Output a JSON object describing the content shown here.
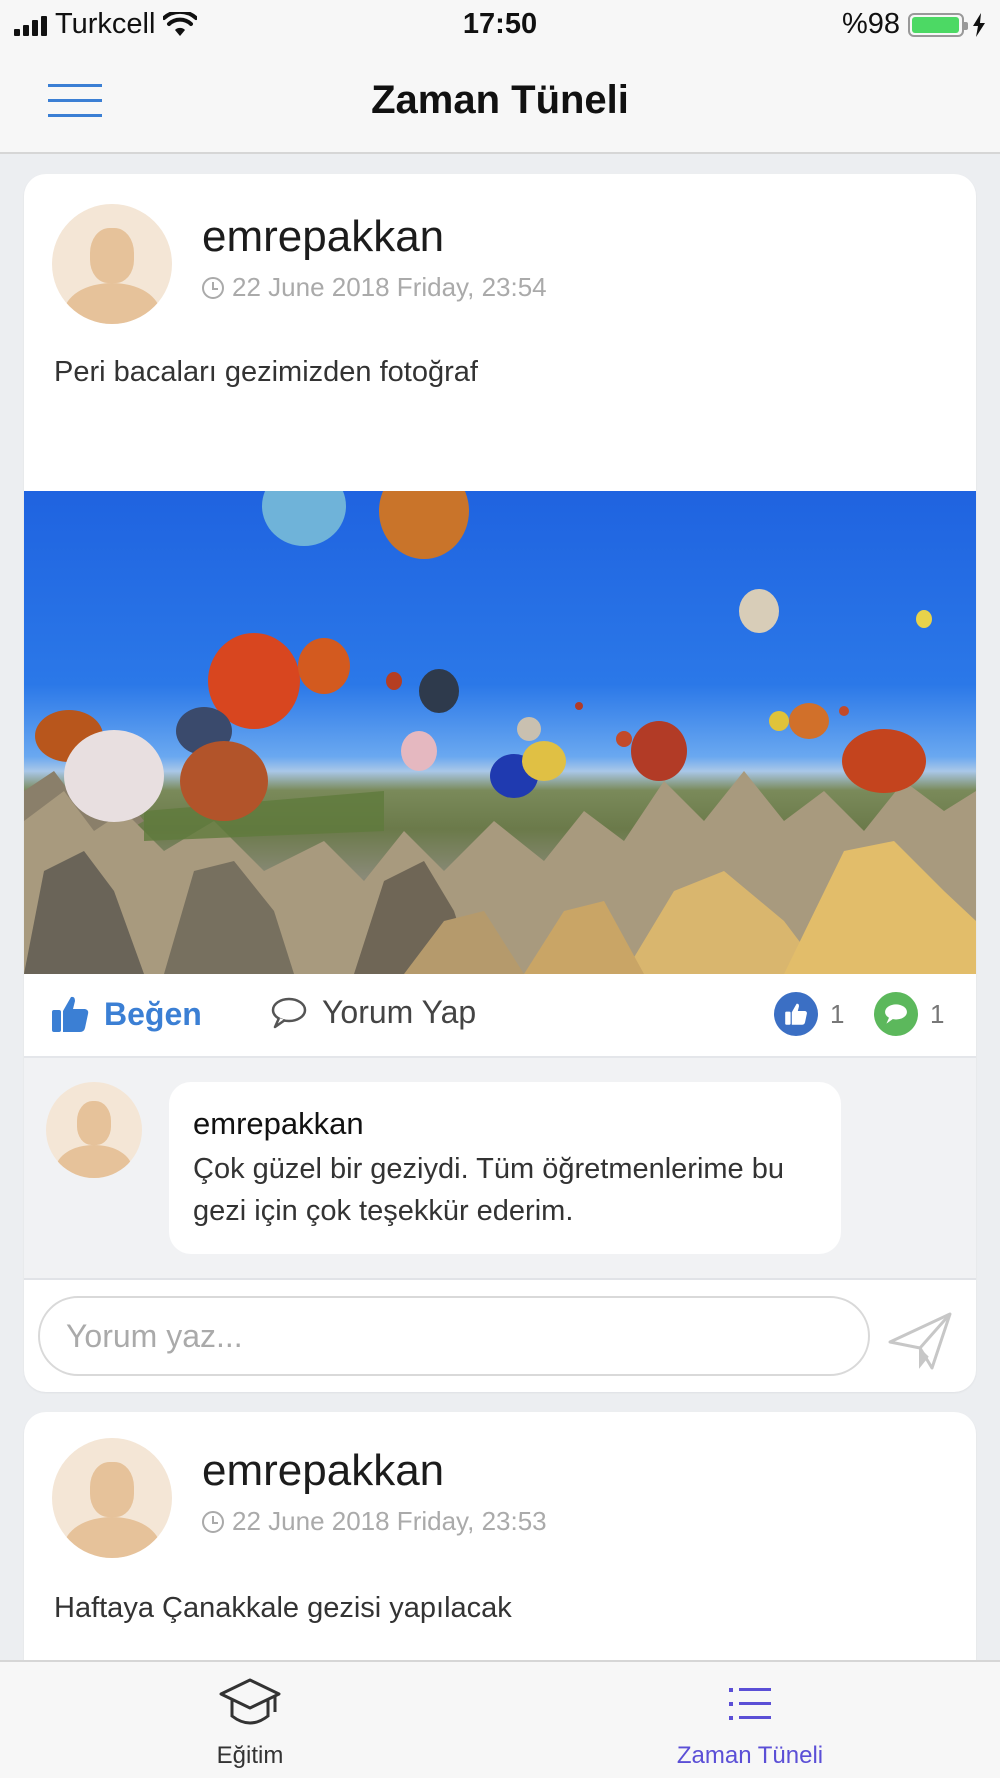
{
  "status_bar": {
    "carrier": "Turkcell",
    "time": "17:50",
    "battery": "%98",
    "battery_level": 0.98,
    "battery_color": "#4cd964"
  },
  "header": {
    "title": "Zaman Tüneli",
    "menu_icon": "hamburger-menu-icon",
    "accent": "#3b7fd4"
  },
  "posts": [
    {
      "username": "emrepakkan",
      "timestamp": "22 June 2018 Friday, 23:54",
      "text": "Peri bacaları gezimizden fotoğraf",
      "actions": {
        "like_label": "Beğen",
        "comment_label": "Yorum Yap"
      },
      "like_count": "1",
      "comment_count": "1",
      "comments": [
        {
          "author": "emrepakkan",
          "text": "Çok güzel bir geziydi. Tüm öğretmenlerime bu gezi için çok teşekkür ederim."
        }
      ],
      "comment_input": {
        "placeholder": "Yorum yaz..."
      }
    },
    {
      "username": "emrepakkan",
      "timestamp": "22 June 2018 Friday, 23:53",
      "text": "Haftaya Çanakkale gezisi yapılacak"
    }
  ],
  "tab_bar": {
    "tabs": [
      {
        "label": "Eğitim",
        "icon": "graduation-cap-icon",
        "active": false
      },
      {
        "label": "Zaman Tüneli",
        "icon": "list-icon",
        "active": true
      }
    ],
    "active_color": "#5b4fd6",
    "inactive_color": "#333333"
  }
}
